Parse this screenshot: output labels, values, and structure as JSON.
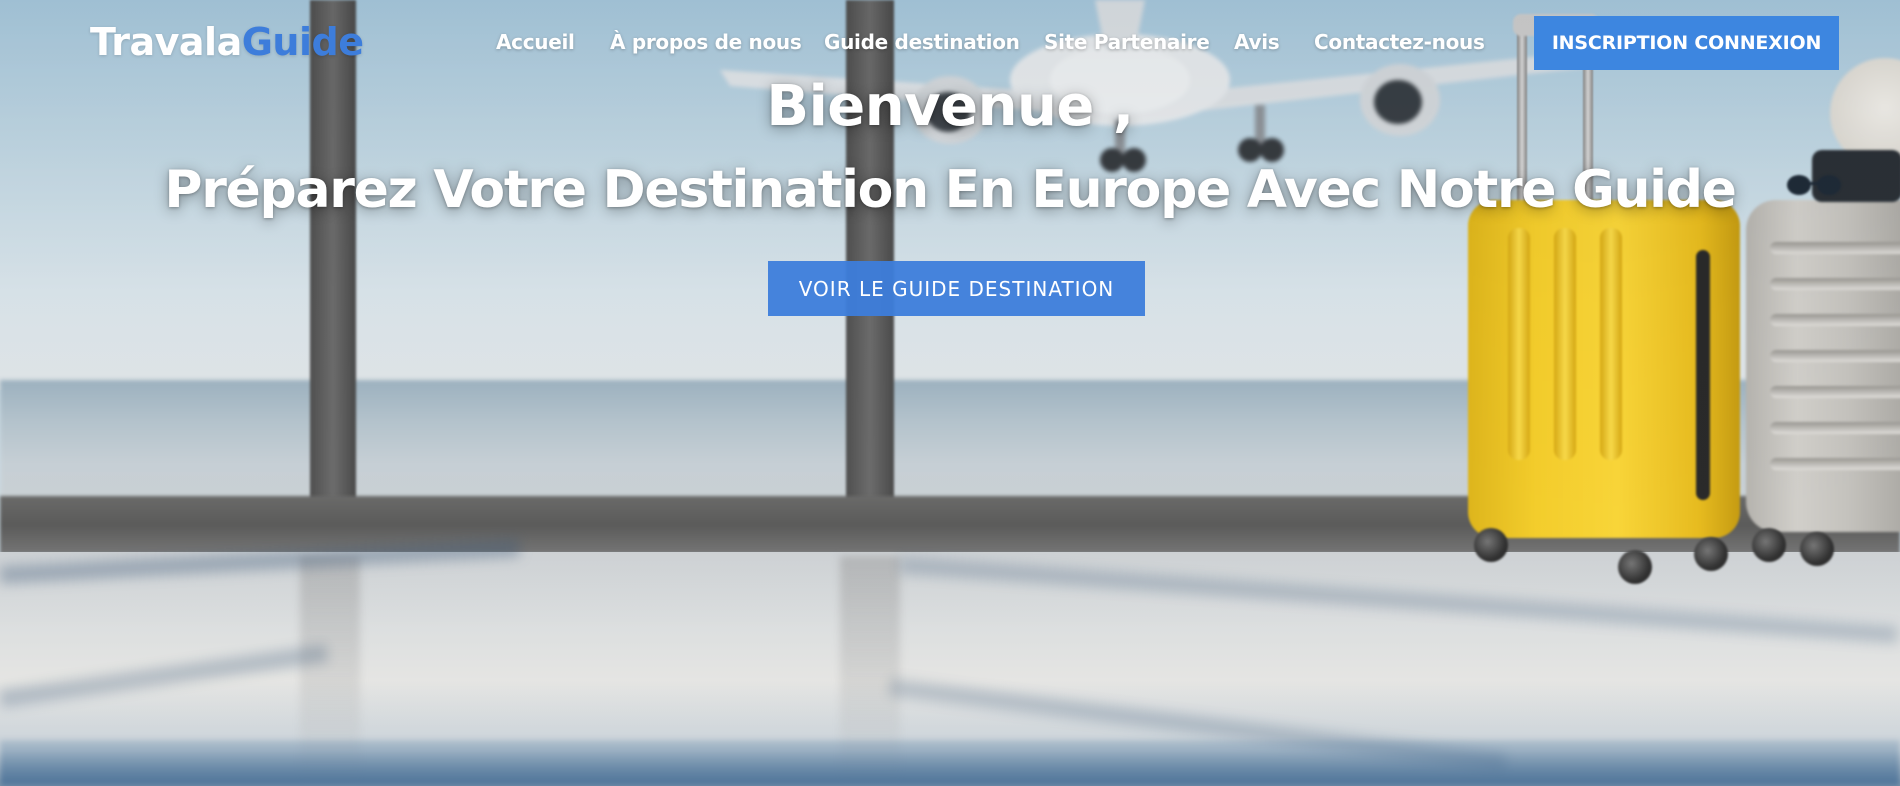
{
  "brand": {
    "logo_part1": "Travala",
    "logo_part2": "Guide",
    "accent_color": "#3d7ddb"
  },
  "nav": {
    "items": [
      {
        "label": "Accueil"
      },
      {
        "label": "À propos de nous"
      },
      {
        "label": "Guide destination"
      },
      {
        "label": "Site Partenaire"
      },
      {
        "label": "Avis"
      },
      {
        "label": "Contactez-nous"
      }
    ],
    "auth_button": "INSCRIPTION CONNEXION",
    "auth_button_color": "#3d86e0"
  },
  "hero": {
    "title_line1": "Bienvenue ,",
    "title_line2": "Préparez Votre Destination En Europe Avec Notre Guide",
    "cta_label": "VOIR LE GUIDE DESTINATION",
    "background_scene": "airport window with airplane and suitcases"
  }
}
